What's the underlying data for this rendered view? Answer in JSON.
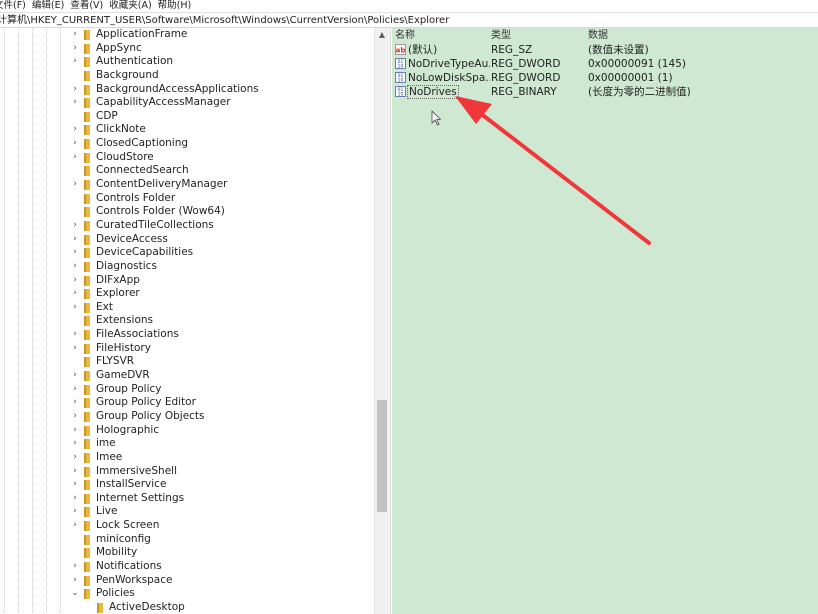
{
  "menu": {
    "items": [
      "文件(F)",
      "编辑(E)",
      "查看(V)",
      "收藏夹(A)",
      "帮助(H)"
    ]
  },
  "address": {
    "path": "计算机\\HKEY_CURRENT_USER\\Software\\Microsoft\\Windows\\CurrentVersion\\Policies\\Explorer"
  },
  "tree": {
    "items": [
      {
        "label": "ApplicationFrame",
        "expandable": true
      },
      {
        "label": "AppSync",
        "expandable": true
      },
      {
        "label": "Authentication",
        "expandable": true
      },
      {
        "label": "Background",
        "expandable": false
      },
      {
        "label": "BackgroundAccessApplications",
        "expandable": true
      },
      {
        "label": "CapabilityAccessManager",
        "expandable": true
      },
      {
        "label": "CDP",
        "expandable": false
      },
      {
        "label": "ClickNote",
        "expandable": true
      },
      {
        "label": "ClosedCaptioning",
        "expandable": true
      },
      {
        "label": "CloudStore",
        "expandable": true
      },
      {
        "label": "ConnectedSearch",
        "expandable": false
      },
      {
        "label": "ContentDeliveryManager",
        "expandable": true
      },
      {
        "label": "Controls Folder",
        "expandable": false
      },
      {
        "label": "Controls Folder (Wow64)",
        "expandable": false
      },
      {
        "label": "CuratedTileCollections",
        "expandable": true
      },
      {
        "label": "DeviceAccess",
        "expandable": true
      },
      {
        "label": "DeviceCapabilities",
        "expandable": true
      },
      {
        "label": "Diagnostics",
        "expandable": true
      },
      {
        "label": "DIFxApp",
        "expandable": true
      },
      {
        "label": "Explorer",
        "expandable": true
      },
      {
        "label": "Ext",
        "expandable": true
      },
      {
        "label": "Extensions",
        "expandable": false
      },
      {
        "label": "FileAssociations",
        "expandable": true
      },
      {
        "label": "FileHistory",
        "expandable": true
      },
      {
        "label": "FLYSVR",
        "expandable": false
      },
      {
        "label": "GameDVR",
        "expandable": true
      },
      {
        "label": "Group Policy",
        "expandable": true
      },
      {
        "label": "Group Policy Editor",
        "expandable": true
      },
      {
        "label": "Group Policy Objects",
        "expandable": true
      },
      {
        "label": "Holographic",
        "expandable": true
      },
      {
        "label": "ime",
        "expandable": true
      },
      {
        "label": "Imee",
        "expandable": true
      },
      {
        "label": "ImmersiveShell",
        "expandable": true
      },
      {
        "label": "InstallService",
        "expandable": true
      },
      {
        "label": "Internet Settings",
        "expandable": true
      },
      {
        "label": "Live",
        "expandable": true
      },
      {
        "label": "Lock Screen",
        "expandable": true
      },
      {
        "label": "miniconfig",
        "expandable": false
      },
      {
        "label": "Mobility",
        "expandable": false
      },
      {
        "label": "Notifications",
        "expandable": true
      },
      {
        "label": "PenWorkspace",
        "expandable": true
      },
      {
        "label": "Policies",
        "expandable": true,
        "expanded": true
      },
      {
        "label": "ActiveDesktop",
        "expandable": false,
        "child": true
      }
    ]
  },
  "values": {
    "headers": {
      "name": "名称",
      "type": "类型",
      "data": "数据"
    },
    "rows": [
      {
        "icon": "string-value-icon",
        "name": "(默认)",
        "type": "REG_SZ",
        "data": "(数值未设置)"
      },
      {
        "icon": "binary-value-icon",
        "name": "NoDriveTypeAu...",
        "type": "REG_DWORD",
        "data": "0x00000091 (145)"
      },
      {
        "icon": "binary-value-icon",
        "name": "NoLowDiskSpa...",
        "type": "REG_DWORD",
        "data": "0x00000001 (1)"
      },
      {
        "icon": "binary-value-icon",
        "name": "NoDrives",
        "type": "REG_BINARY",
        "data": "(长度为零的二进制值)",
        "selected": true
      }
    ]
  },
  "colors": {
    "values_background": "#cfe8d2",
    "folder": "#e8b93a",
    "arrow": "#f0383a"
  }
}
